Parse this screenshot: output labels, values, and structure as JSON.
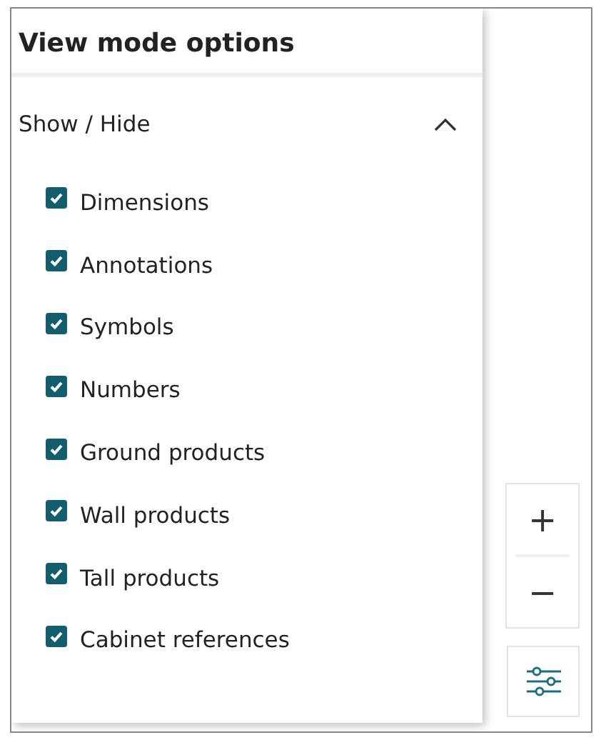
{
  "panel": {
    "title": "View mode options"
  },
  "section": {
    "title": "Show / Hide",
    "expanded": true
  },
  "options": [
    {
      "label": "Dimensions",
      "checked": true
    },
    {
      "label": "Annotations",
      "checked": true
    },
    {
      "label": "Symbols",
      "checked": true
    },
    {
      "label": "Numbers",
      "checked": true
    },
    {
      "label": "Ground products",
      "checked": true
    },
    {
      "label": "Wall products",
      "checked": true
    },
    {
      "label": "Tall products",
      "checked": true
    },
    {
      "label": "Cabinet references",
      "checked": true
    }
  ],
  "zoom": {
    "in": "+",
    "out": "−"
  }
}
